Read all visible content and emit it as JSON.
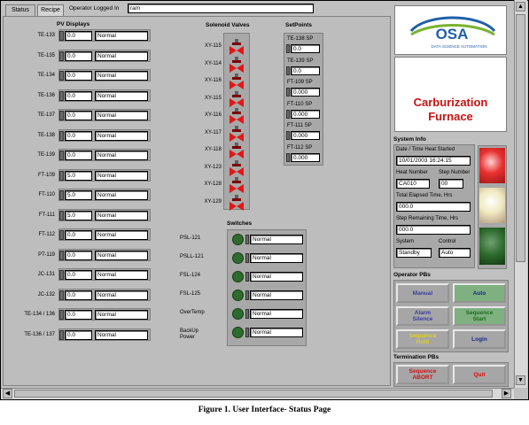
{
  "tabs": {
    "status": "Status",
    "recipe": "Recipe"
  },
  "operator": {
    "label": "Operator Logged In",
    "value": "ram"
  },
  "pv_header": "PV Displays",
  "pv_rows": [
    {
      "label": "TE-133",
      "value": "0.0",
      "status": "Normal"
    },
    {
      "label": "TE-135",
      "value": "0.0",
      "status": "Normal"
    },
    {
      "label": "TE-134",
      "value": "0.0",
      "status": "Normal"
    },
    {
      "label": "TE-136",
      "value": "0.0",
      "status": "Normal"
    },
    {
      "label": "TE-137",
      "value": "0.0",
      "status": "Normal"
    },
    {
      "label": "TE-138",
      "value": "0.0",
      "status": "Normal"
    },
    {
      "label": "TE-139",
      "value": "0.0",
      "status": "Normal"
    },
    {
      "label": "FT-109",
      "value": "5.0",
      "status": "Normal"
    },
    {
      "label": "FT-110",
      "value": "5.0",
      "status": "Normal"
    },
    {
      "label": "FT-111",
      "value": "5.0",
      "status": "Normal"
    },
    {
      "label": "FT-112",
      "value": "0.0",
      "status": "Normal"
    },
    {
      "label": "PT-119",
      "value": "0.0",
      "status": "Normal"
    },
    {
      "label": "JC-131",
      "value": "0.0",
      "status": "Normal"
    },
    {
      "label": "JC-132",
      "value": "0.0",
      "status": "Normal"
    },
    {
      "label": "TE-134 / 136",
      "value": "0.0",
      "status": "Normal"
    },
    {
      "label": "TE-136 / 137",
      "value": "0.0",
      "status": "Normal"
    }
  ],
  "valves_header": "Solenoid Valves",
  "valves": [
    "XY-115",
    "XY-114",
    "XY-116",
    "XY-115",
    "XY-116",
    "XY-117",
    "XY-118",
    "XY-123",
    "XY-128",
    "XY-129"
  ],
  "setpoints_header": "SetPoints",
  "setpoints": [
    {
      "label": "TE-138 SP",
      "value": "0.0"
    },
    {
      "label": "TE-139 SP",
      "value": "0.0"
    },
    {
      "label": "FT-109 SP",
      "value": "0.000"
    },
    {
      "label": "FT-110 SP",
      "value": "0.000"
    },
    {
      "label": "FT-111 SP",
      "value": "0.000"
    },
    {
      "label": "FT-112 SP",
      "value": "0.000"
    }
  ],
  "switches_header": "Switches",
  "switches": [
    {
      "label": "PSL-121",
      "status": "Normal"
    },
    {
      "label": "PSLL-121",
      "status": "Normal"
    },
    {
      "label": "FSL-124",
      "status": "Normal"
    },
    {
      "label": "FSL-125",
      "status": "Normal"
    },
    {
      "label": "OverTemp",
      "status": "Normal"
    },
    {
      "label": "BackUp\nPower",
      "status": "Normal"
    }
  ],
  "logo": {
    "text": "OSA",
    "subtitle": "DATA SCIENCE AUTOMATION"
  },
  "product": {
    "line1": "Carburization",
    "line2": "Furnace"
  },
  "system_info": {
    "header": "System Info",
    "date_label": "Date / Time Heat Started",
    "date_value": "10/01/2003 16:24:15",
    "heat_label": "Heat Number",
    "heat_value": "CA010",
    "step_label": "Step Number",
    "step_value": "00",
    "elapsed_label": "Total Elapsed Time, Hrs",
    "elapsed_value": "000.0",
    "remaining_label": "Step Remaining Time, Hrs",
    "remaining_value": "000.0",
    "system_label": "System",
    "system_value": "Standby",
    "control_label": "Control",
    "control_value": "Auto"
  },
  "operator_pbs": {
    "header": "Operator PBs",
    "buttons": [
      {
        "label": "Manual",
        "color": "#3a3aa0",
        "style": "gray"
      },
      {
        "label": "Auto",
        "color": "#1a2a8a",
        "style": "green"
      },
      {
        "label": "Alarm\nSilence",
        "color": "#3a3aa0",
        "style": "gray"
      },
      {
        "label": "Sequence\nStart",
        "color": "#1f6a1f",
        "style": "green"
      },
      {
        "label": "Sequence\nHold",
        "color": "#e0d020",
        "style": "gray"
      },
      {
        "label": "Login",
        "color": "#1a2a8a",
        "style": "gray"
      }
    ]
  },
  "termination_pbs": {
    "header": "Termination PBs",
    "buttons": [
      {
        "label": "Sequence\nABORT",
        "color": "#d01010"
      },
      {
        "label": "Quit",
        "color": "#d01010"
      }
    ]
  },
  "caption": "Figure 1. User Interface- Status Page",
  "colors": {
    "valve": "#e01818",
    "alarm_red": "#e83030",
    "alarm_yellow": "#f0e8c0",
    "alarm_green": "#2d6a2d",
    "title_red": "#cc1111",
    "logo_blue": "#1e5fa8",
    "logo_green": "#7ab32e"
  }
}
